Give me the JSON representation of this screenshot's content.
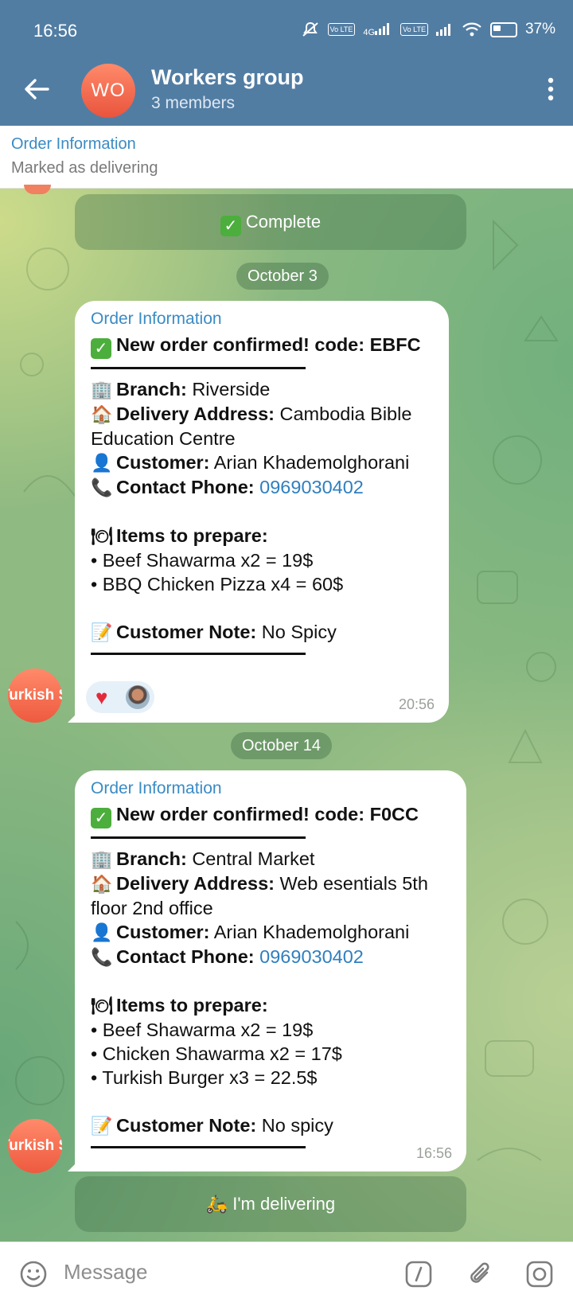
{
  "status_bar": {
    "time": "16:56",
    "net_4g": "4G",
    "volte1": "Vo LTE",
    "volte2": "Vo LTE",
    "battery": "37%",
    "icons": [
      "mute-icon",
      "volte-icon",
      "signal-icon",
      "wifi-icon",
      "battery-icon"
    ]
  },
  "header": {
    "avatar_initials": "WO",
    "title": "Workers group",
    "subtitle": "3 members"
  },
  "pinned": {
    "title": "Order Information",
    "subtitle": "Marked as delivering"
  },
  "buttons": {
    "complete": "Complete",
    "delivering": "I'm delivering"
  },
  "dates": {
    "first": "October 3",
    "second": "October 14"
  },
  "messages": [
    {
      "sender": "Order Information",
      "sender_avatar": "Turkish S",
      "headline_label": "New order confirmed! code:",
      "headline_code": "EBFC",
      "branch_label": "Branch:",
      "branch": "Riverside",
      "address_label": "Delivery Address:",
      "address_line1": "Cambodia Bible",
      "address_line2": "Education Centre",
      "customer_label": "Customer:",
      "customer": "Arian Khademolghorani",
      "phone_label": "Contact Phone:",
      "phone": "0969030402",
      "items_label": "Items to prepare:",
      "items": [
        "• Beef Shawarma x2 = 19$",
        "• BBQ Chicken Pizza x4 = 60$"
      ],
      "note_label": "Customer Note:",
      "note": "No Spicy",
      "time": "20:56",
      "reactions": [
        "heart",
        "user-avatar"
      ]
    },
    {
      "sender": "Order Information",
      "sender_avatar": "Turkish S",
      "headline_label": "New order confirmed! code:",
      "headline_code": "F0CC",
      "branch_label": "Branch:",
      "branch": "Central Market",
      "address_label": "Delivery Address:",
      "address_line1": "Web esentials 5th",
      "address_line2": "floor 2nd office",
      "customer_label": "Customer:",
      "customer": "Arian Khademolghorani",
      "phone_label": "Contact Phone:",
      "phone": "0969030402",
      "items_label": "Items to prepare:",
      "items": [
        "• Beef Shawarma x2 = 19$",
        "• Chicken Shawarma x2 = 17$",
        "• Turkish Burger x3 = 22.5$"
      ],
      "note_label": "Customer Note:",
      "note": "No spicy",
      "time": "16:56"
    }
  ],
  "input": {
    "placeholder": "Message"
  },
  "colors": {
    "header": "#527da3",
    "accent_link": "#2f7fbf",
    "sender_name": "#3a8bc4",
    "avatar": "#ee5a3f"
  }
}
